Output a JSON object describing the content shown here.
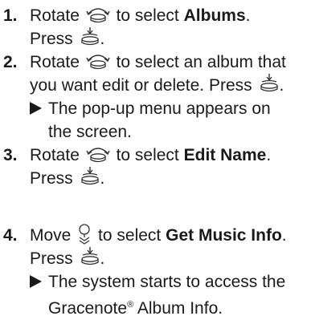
{
  "steps": [
    {
      "number": "1.",
      "lines": [
        {
          "a": "Rotate",
          "b": "to select",
          "c": "Albums",
          "d": "."
        },
        {
          "a": "Press",
          "d": "."
        }
      ]
    },
    {
      "number": "2.",
      "lines": [
        {
          "a": "Rotate",
          "b": "to select an album that"
        },
        {
          "a": "you want edit or delete. Press",
          "d": "."
        }
      ],
      "note": [
        "The pop-up menu appears on",
        "the screen."
      ]
    },
    {
      "number": "3.",
      "lines": [
        {
          "a": "Rotate",
          "b": "to select",
          "c": "Edit Name",
          "d": "."
        },
        {
          "a": "Press",
          "d": "."
        }
      ]
    },
    {
      "number": "4.",
      "lines": [
        {
          "a": "Move",
          "b": "to select",
          "c": "Get Music Info",
          "d": "."
        },
        {
          "a": "Press",
          "d": "."
        }
      ],
      "note": [
        "The system starts to access the",
        "Gracenote",
        "Album Info."
      ],
      "note_mark": "®"
    }
  ],
  "icons": {
    "rotate": "interface-dial-rotate-icon",
    "press": "interface-dial-press-icon",
    "move": "interface-dial-move-down-icon"
  }
}
